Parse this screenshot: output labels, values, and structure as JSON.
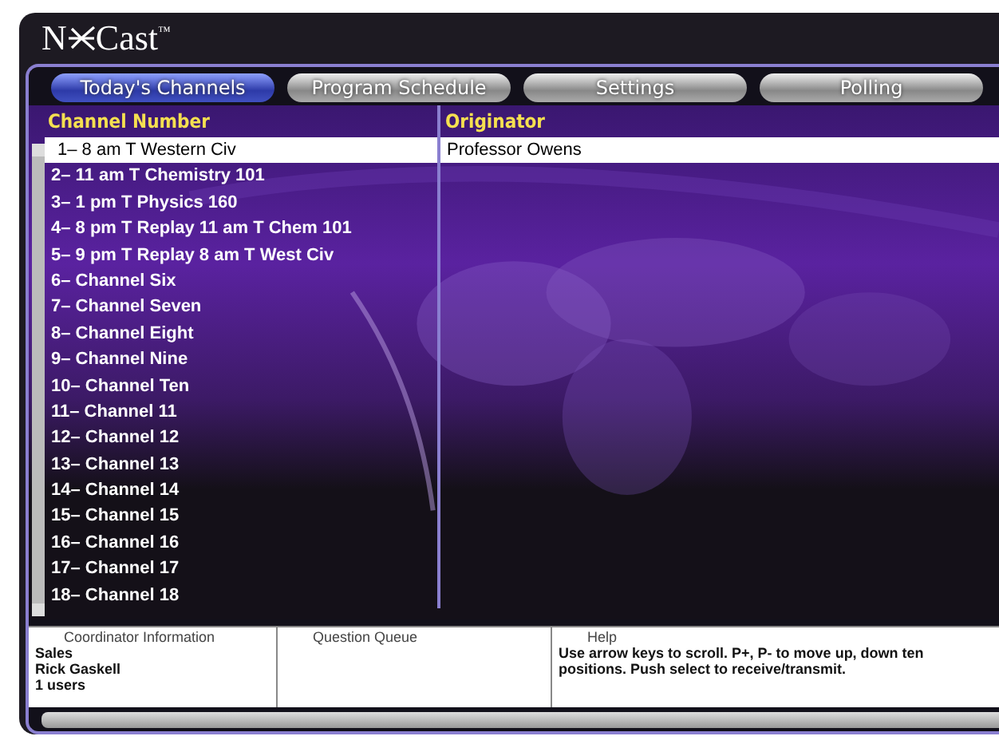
{
  "logo": {
    "before": "N",
    "after": "Cast",
    "trademark": "™"
  },
  "tabs": [
    {
      "label": "Today's Channels",
      "selected": true
    },
    {
      "label": "Program Schedule",
      "selected": false
    },
    {
      "label": "Settings",
      "selected": false
    },
    {
      "label": "Polling",
      "selected": false
    }
  ],
  "table": {
    "columns": [
      "Channel Number",
      "Originator"
    ],
    "rows": [
      {
        "channel": "1– 8 am T Western Civ",
        "originator": "Professor Owens",
        "selected": true
      },
      {
        "channel": "2– 11 am T Chemistry 101",
        "selected": false
      },
      {
        "channel": "3– 1 pm T Physics 160",
        "selected": false
      },
      {
        "channel": "4– 8 pm T Replay 11 am T Chem 101",
        "selected": false
      },
      {
        "channel": "5– 9 pm T Replay 8 am T West Civ",
        "selected": false
      },
      {
        "channel": "6– Channel Six",
        "selected": false
      },
      {
        "channel": "7– Channel Seven",
        "selected": false
      },
      {
        "channel": "8– Channel Eight",
        "selected": false
      },
      {
        "channel": "9– Channel Nine",
        "selected": false
      },
      {
        "channel": "10– Channel Ten",
        "selected": false
      },
      {
        "channel": "11– Channel 11",
        "selected": false
      },
      {
        "channel": "12– Channel 12",
        "selected": false
      },
      {
        "channel": "13– Channel 13",
        "selected": false
      },
      {
        "channel": "14– Channel 14",
        "selected": false
      },
      {
        "channel": "15– Channel 15",
        "selected": false
      },
      {
        "channel": "16– Channel 16",
        "selected": false
      },
      {
        "channel": "17– Channel 17",
        "selected": false
      },
      {
        "channel": "18– Channel 18",
        "selected": false
      }
    ]
  },
  "info_panels": [
    {
      "title": "Coordinator Information",
      "lines": [
        "Sales",
        "Rick Gaskell",
        "1 users"
      ]
    },
    {
      "title": "Question Queue"
    },
    {
      "title": "Help",
      "lines": [
        "Use arrow keys to scroll. P+, P- to move up, down ten positions. Push select to receive/transmit."
      ]
    }
  ]
}
